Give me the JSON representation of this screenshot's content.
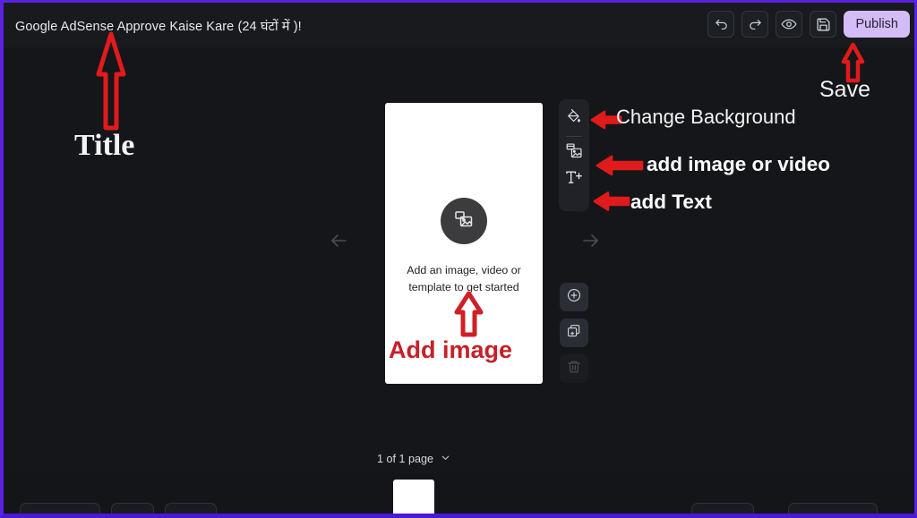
{
  "app": {
    "document_title": "Google AdSense Approve Kaise Kare (24 घंटों में )!",
    "background_color": "#141619",
    "border_color": "#5b21e0",
    "accent_color": "#d4bcf6",
    "annotation_color": "#e01b1b"
  },
  "toolbar": {
    "undo_icon": "undo-icon",
    "redo_icon": "redo-icon",
    "preview_icon": "eye-icon",
    "save_icon": "save-floppy-icon",
    "publish_label": "Publish"
  },
  "canvas": {
    "placeholder_text": "Add an image, video or template to get started",
    "placeholder_icon": "image-media-icon",
    "nav_prev_icon": "arrow-left-icon",
    "nav_next_icon": "arrow-right-icon"
  },
  "tool_rail": {
    "items": [
      {
        "name": "change-background",
        "icon": "paint-bucket-icon"
      },
      {
        "name": "add-image-or-video",
        "icon": "image-video-icon"
      },
      {
        "name": "add-text",
        "icon": "text-plus-icon"
      }
    ]
  },
  "page_tools": {
    "items": [
      {
        "name": "add-page",
        "icon": "plus-circle-icon",
        "disabled": false
      },
      {
        "name": "duplicate-page",
        "icon": "duplicate-page-icon",
        "disabled": false
      },
      {
        "name": "delete-page",
        "icon": "trash-icon",
        "disabled": true
      }
    ]
  },
  "pagination": {
    "label": "1 of 1 page",
    "chevron_icon": "chevron-down-icon"
  },
  "annotations": [
    {
      "id": "title",
      "label": "Title",
      "arrow": "arrow-up",
      "target": "document title"
    },
    {
      "id": "save",
      "label": "Save",
      "arrow": "arrow-up",
      "target": "save button"
    },
    {
      "id": "change-background",
      "label": "Change Background",
      "arrow": "arrow-left",
      "target": "paint bucket tool"
    },
    {
      "id": "add-image-or-video",
      "label": "add image or video",
      "arrow": "arrow-left",
      "target": "image video tool"
    },
    {
      "id": "add-text",
      "label": "add Text",
      "arrow": "arrow-left",
      "target": "text tool"
    },
    {
      "id": "add-image",
      "label": "Add image",
      "arrow": "arrow-up",
      "target": "canvas placeholder"
    }
  ]
}
